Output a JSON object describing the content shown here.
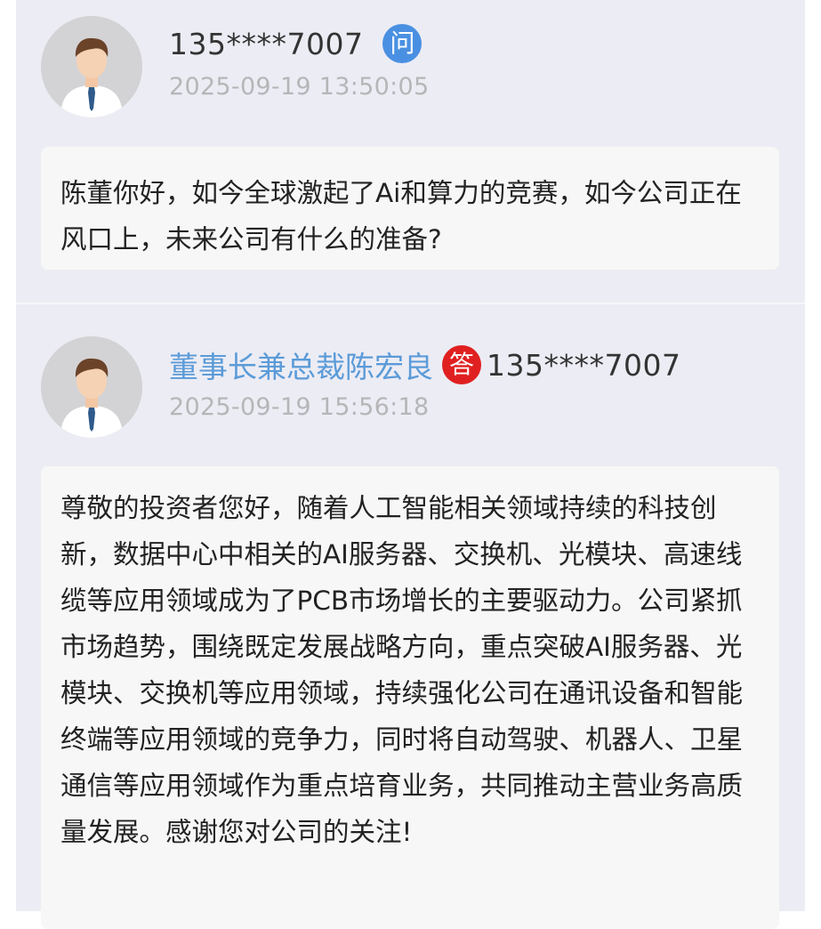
{
  "question": {
    "user": "135****7007",
    "badge": "问",
    "time": "2025-09-19 13:50:05",
    "content": "陈董你好，如今全球激起了Ai和算力的竞赛，如今公司正在风口上，未来公司有什么的准备?"
  },
  "answer": {
    "responder": "董事长兼总裁陈宏良",
    "badge": "答",
    "reply_to": "135****7007",
    "time": "2025-09-19 15:56:18",
    "content": "尊敬的投资者您好，随着人工智能相关领域持续的科技创新，数据中心中相关的AI服务器、交换机、光模块、高速线缆等应用领域成为了PCB市场增长的主要驱动力。公司紧抓市场趋势，围绕既定发展战略方向，重点突破AI服务器、光模块、交换机等应用领域，持续强化公司在通讯设备和智能终端等应用领域的竞争力，同时将自动驾驶、机器人、卫星通信等应用领域作为重点培育业务，共同推动主营业务高质量发展。感谢您对公司的关注!"
  },
  "colors": {
    "question_badge": "#4a90e2",
    "answer_badge": "#e02020",
    "responder_name": "#5b9bd8"
  },
  "icons": {
    "avatar": "user-avatar-icon"
  }
}
